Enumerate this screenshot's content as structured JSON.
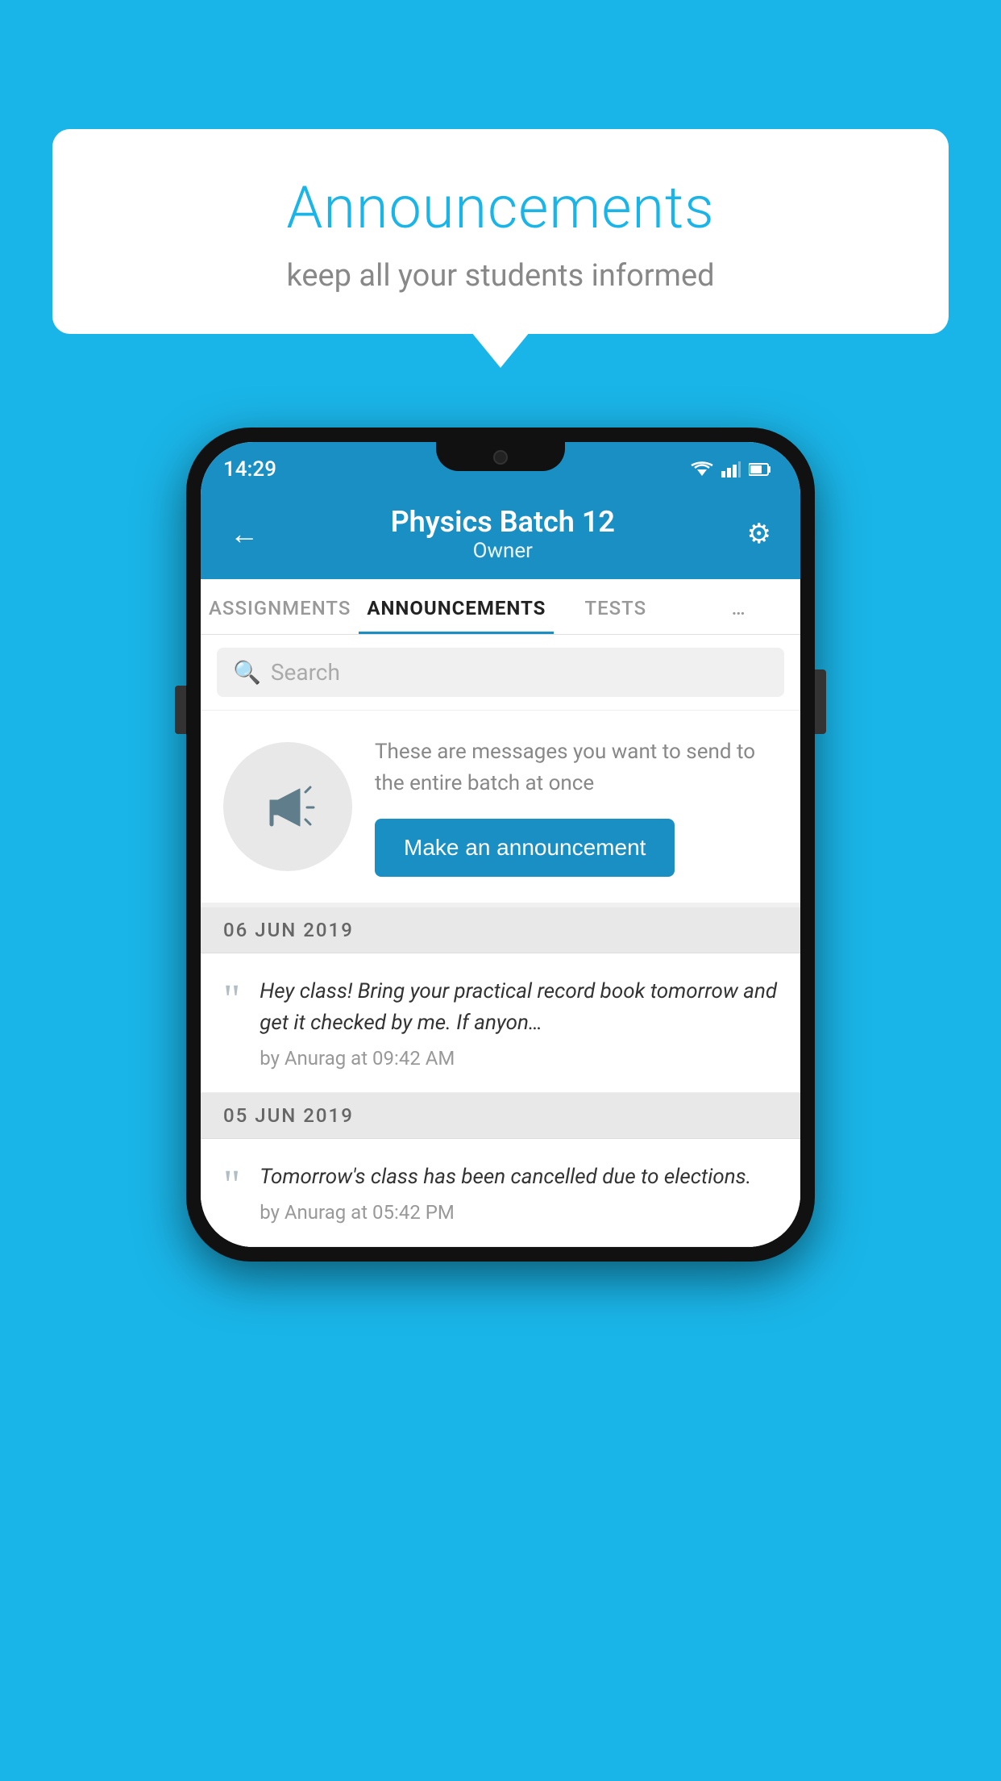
{
  "background_color": "#1ab5e8",
  "speech_bubble": {
    "title": "Announcements",
    "subtitle": "keep all your students informed"
  },
  "phone": {
    "status_bar": {
      "time": "14:29"
    },
    "app_bar": {
      "back_label": "←",
      "title": "Physics Batch 12",
      "subtitle": "Owner",
      "gear_label": "⚙"
    },
    "tabs": [
      {
        "label": "ASSIGNMENTS",
        "active": false
      },
      {
        "label": "ANNOUNCEMENTS",
        "active": true
      },
      {
        "label": "TESTS",
        "active": false
      },
      {
        "label": "…",
        "active": false
      }
    ],
    "search": {
      "placeholder": "Search"
    },
    "announcement_prompt": {
      "description": "These are messages you want to send to the entire batch at once",
      "button_label": "Make an announcement"
    },
    "announcement_groups": [
      {
        "date": "06  JUN  2019",
        "items": [
          {
            "text": "Hey class! Bring your practical record book tomorrow and get it checked by me. If anyon…",
            "meta": "by Anurag at 09:42 AM"
          }
        ]
      },
      {
        "date": "05  JUN  2019",
        "items": [
          {
            "text": "Tomorrow's class has been cancelled due to elections.",
            "meta": "by Anurag at 05:42 PM"
          }
        ]
      }
    ]
  }
}
